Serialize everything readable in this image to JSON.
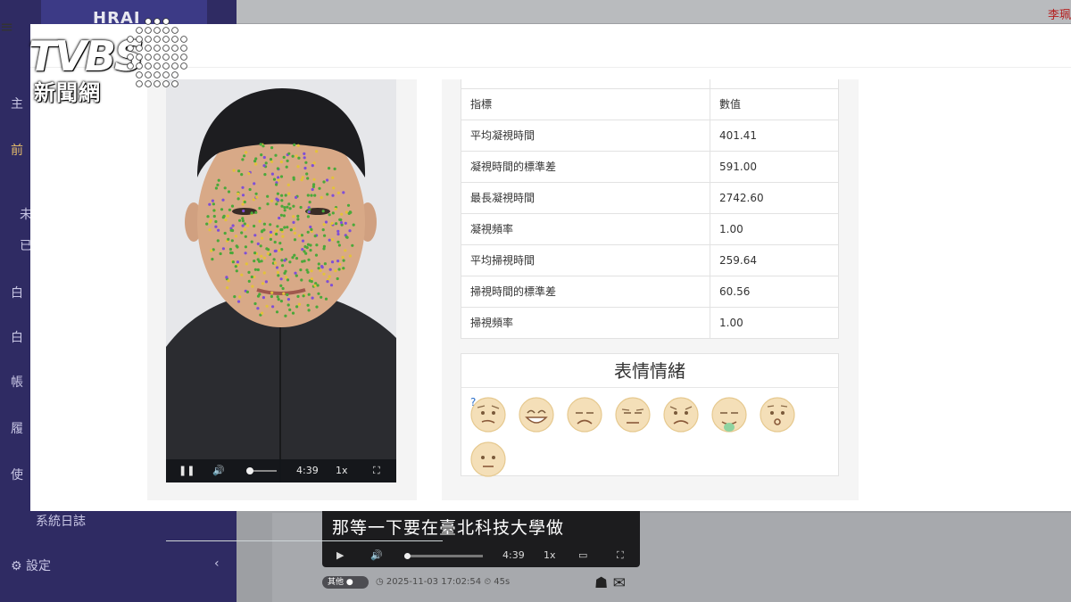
{
  "background": {
    "brand": "HRAI",
    "user": "李珮",
    "sidebar": {
      "items": [
        {
          "label": "主"
        },
        {
          "label": "前"
        },
        {
          "label": "未"
        },
        {
          "label": "已"
        },
        {
          "label": "白"
        },
        {
          "label": "白"
        },
        {
          "label": "帳"
        },
        {
          "label": "履"
        },
        {
          "label": "使"
        },
        {
          "label": "系統日誌"
        },
        {
          "label": "設定"
        }
      ]
    },
    "video": {
      "caption": "那等一下要在臺北科技大學做",
      "time": "4:39",
      "speed": "1x"
    },
    "meta": {
      "badge": "其他",
      "timestamp": "2025-11-03 17:02:54",
      "duration": "45s"
    }
  },
  "modal": {
    "video": {
      "time": "4:39",
      "speed": "1x"
    },
    "metrics": {
      "headers": [
        "指標",
        "數值"
      ],
      "rows": [
        {
          "label": "平均凝視時間",
          "value": "401.41"
        },
        {
          "label": "凝視時間的標準差",
          "value": "591.00"
        },
        {
          "label": "最長凝視時間",
          "value": "2742.60"
        },
        {
          "label": "凝視頻率",
          "value": "1.00"
        },
        {
          "label": "平均掃視時間",
          "value": "259.64"
        },
        {
          "label": "掃視時間的標準差",
          "value": "60.56"
        },
        {
          "label": "掃視頻率",
          "value": "1.00"
        }
      ]
    },
    "emotions": {
      "title": "表情情緒",
      "items": [
        {
          "icon": "confused-face-icon"
        },
        {
          "icon": "grinning-face-icon"
        },
        {
          "icon": "sad-face-icon"
        },
        {
          "icon": "unamused-face-icon"
        },
        {
          "icon": "fearful-face-icon"
        },
        {
          "icon": "nauseated-face-icon"
        },
        {
          "icon": "surprised-face-icon"
        },
        {
          "icon": "neutral-face-icon"
        }
      ]
    }
  },
  "watermark": {
    "logo": "TVBS",
    "sub": "新聞網"
  }
}
